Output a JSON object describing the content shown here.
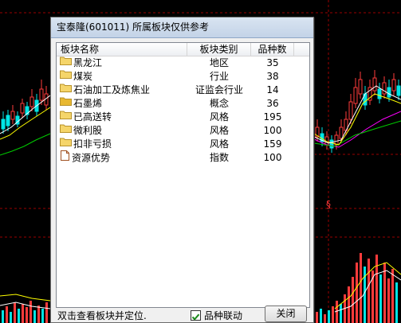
{
  "dialog": {
    "title": "宝泰隆(601011)  所属板块仅供参考",
    "columns": [
      "板块名称",
      "板块类别",
      "品种数"
    ],
    "rows": [
      {
        "name": "黑龙江",
        "category": "地区",
        "count": "35",
        "icon": "folder-icon"
      },
      {
        "name": "煤炭",
        "category": "行业",
        "count": "38",
        "icon": "folder-icon"
      },
      {
        "name": "石油加工及炼焦业",
        "category": "证监会行业",
        "count": "14",
        "icon": "folder-icon"
      },
      {
        "name": "石墨烯",
        "category": "概念",
        "count": "36",
        "icon": "folder-open-icon"
      },
      {
        "name": "已高送转",
        "category": "风格",
        "count": "195",
        "icon": "folder-icon"
      },
      {
        "name": "微利股",
        "category": "风格",
        "count": "100",
        "icon": "folder-icon"
      },
      {
        "name": "扣非亏损",
        "category": "风格",
        "count": "159",
        "icon": "folder-icon"
      },
      {
        "name": "资源优势",
        "category": "指数",
        "count": "100",
        "icon": "document-icon"
      }
    ],
    "status_text": "双击查看板块并定位.",
    "checkbox_label": "品种联动",
    "checkbox_checked": true,
    "close_label": "关闭"
  },
  "background": {
    "marker": "§"
  },
  "colors": {
    "folder": "#f5d56a",
    "folder_open": "#e8b830",
    "chart_red": "#ff3b3b",
    "chart_cyan": "#00e5e5",
    "chart_yellow": "#ffff00",
    "chart_magenta": "#ff00ff",
    "chart_green": "#00cc00"
  }
}
